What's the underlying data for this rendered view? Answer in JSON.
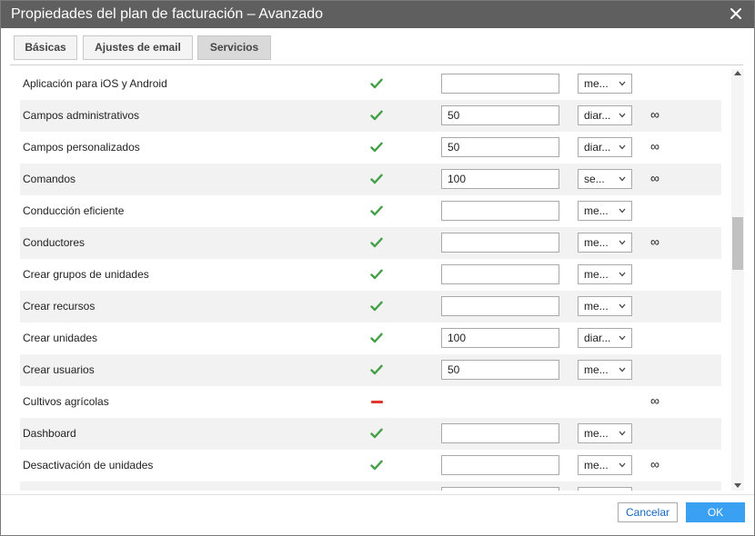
{
  "window": {
    "title": "Propiedades del plan de facturación – Avanzado",
    "close_icon": "close-icon"
  },
  "tabs": [
    {
      "label": "Básicas",
      "active": false
    },
    {
      "label": "Ajustes de email",
      "active": false
    },
    {
      "label": "Servicios",
      "active": true
    }
  ],
  "colors": {
    "titlebar": "#5f5f5f",
    "check": "#43a047",
    "dash": "#e2372a",
    "ok_button": "#3aa0f2",
    "cancel_text": "#1565c0"
  },
  "services": [
    {
      "name": "Aplicación para iOS y Android",
      "status": "check",
      "limit": "",
      "period": "me...",
      "unlimited": ""
    },
    {
      "name": "Campos administrativos",
      "status": "check",
      "limit": "50",
      "period": "diar...",
      "unlimited": "∞"
    },
    {
      "name": "Campos personalizados",
      "status": "check",
      "limit": "50",
      "period": "diar...",
      "unlimited": "∞"
    },
    {
      "name": "Comandos",
      "status": "check",
      "limit": "100",
      "period": "se...",
      "unlimited": "∞"
    },
    {
      "name": "Conducción eficiente",
      "status": "check",
      "limit": "",
      "period": "me...",
      "unlimited": ""
    },
    {
      "name": "Conductores",
      "status": "check",
      "limit": "",
      "period": "me...",
      "unlimited": "∞"
    },
    {
      "name": "Crear grupos de unidades",
      "status": "check",
      "limit": "",
      "period": "me...",
      "unlimited": ""
    },
    {
      "name": "Crear recursos",
      "status": "check",
      "limit": "",
      "period": "me...",
      "unlimited": ""
    },
    {
      "name": "Crear unidades",
      "status": "check",
      "limit": "100",
      "period": "diar...",
      "unlimited": ""
    },
    {
      "name": "Crear usuarios",
      "status": "check",
      "limit": "50",
      "period": "me...",
      "unlimited": ""
    },
    {
      "name": "Cultivos agrícolas",
      "status": "dash",
      "limit": null,
      "period": null,
      "unlimited": "∞"
    },
    {
      "name": "Dashboard",
      "status": "check",
      "limit": "",
      "period": "me...",
      "unlimited": ""
    },
    {
      "name": "Desactivación de unidades",
      "status": "check",
      "limit": "",
      "period": "me...",
      "unlimited": "∞"
    },
    {
      "name": "",
      "status": "none",
      "limit": "",
      "period": "",
      "unlimited": ""
    }
  ],
  "footer": {
    "cancel_label": "Cancelar",
    "ok_label": "OK"
  }
}
